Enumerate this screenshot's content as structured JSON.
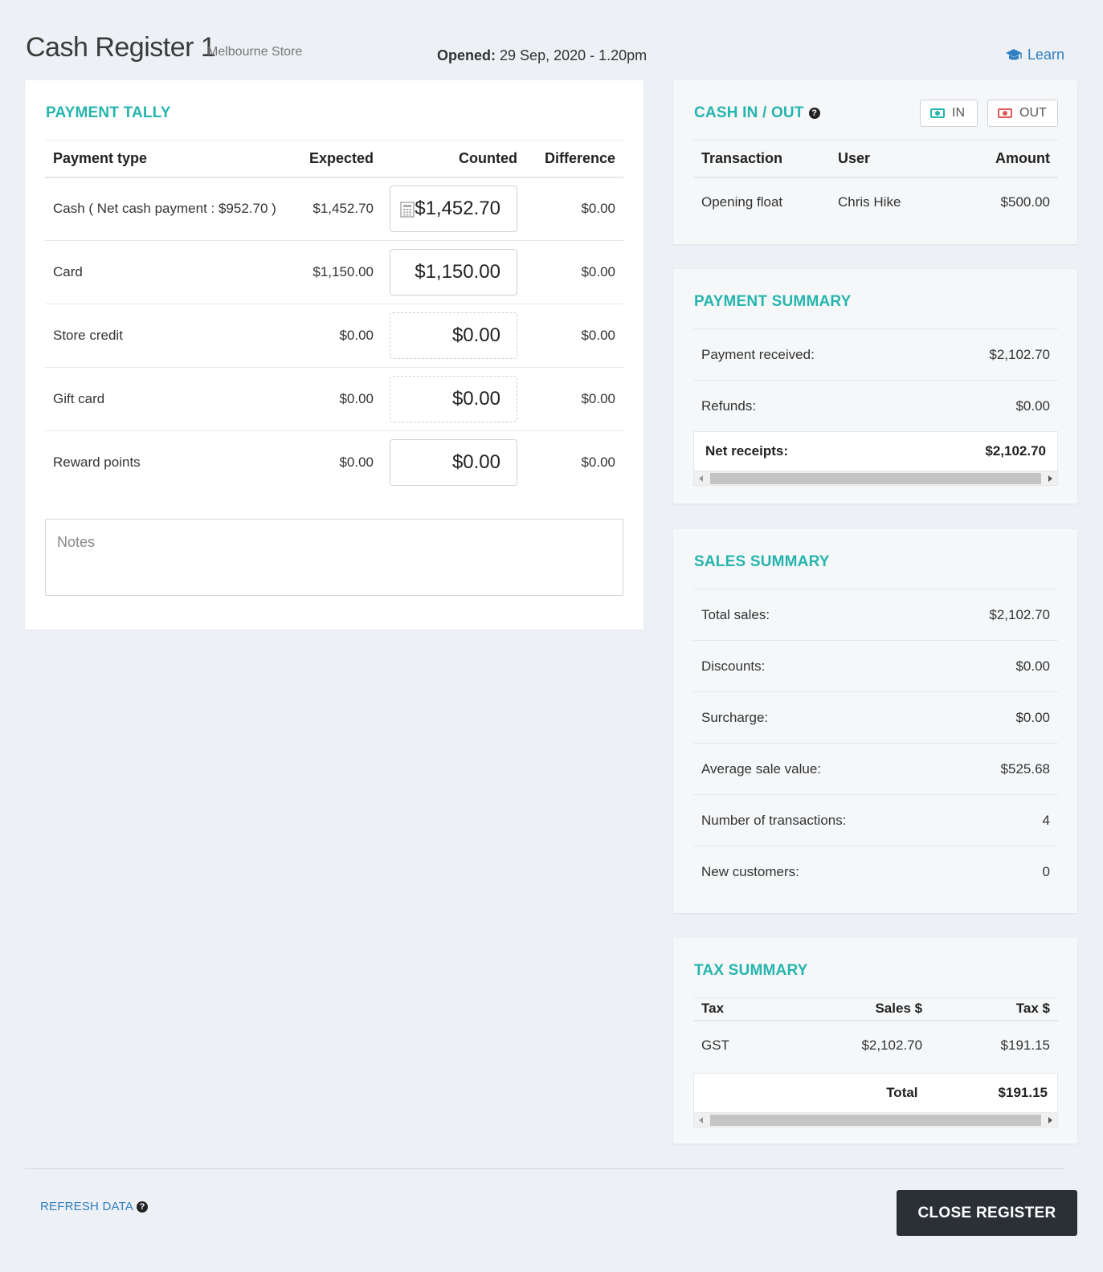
{
  "header": {
    "title": "Cash Register 1",
    "store": "Melbourne Store",
    "opened_label": "Opened:",
    "opened_value": "29 Sep, 2020 - 1.20pm",
    "learn": "Learn"
  },
  "tally": {
    "title": "PAYMENT TALLY",
    "columns": [
      "Payment type",
      "Expected",
      "Counted",
      "Difference"
    ],
    "rows": [
      {
        "type": "Cash ( Net cash payment : $952.70 )",
        "expected": "$1,452.70",
        "counted": "$1,452.70",
        "difference": "$0.00"
      },
      {
        "type": "Card",
        "expected": "$1,150.00",
        "counted": "$1,150.00",
        "difference": "$0.00"
      },
      {
        "type": "Store credit",
        "expected": "$0.00",
        "counted": "$0.00",
        "difference": "$0.00"
      },
      {
        "type": "Gift card",
        "expected": "$0.00",
        "counted": "$0.00",
        "difference": "$0.00"
      },
      {
        "type": "Reward points",
        "expected": "$0.00",
        "counted": "$0.00",
        "difference": "$0.00"
      }
    ],
    "notes_placeholder": "Notes"
  },
  "cash": {
    "title": "CASH IN / OUT",
    "in_label": "IN",
    "out_label": "OUT",
    "columns": [
      "Transaction",
      "User",
      "Amount"
    ],
    "rows": [
      {
        "transaction": "Opening float",
        "user": "Chris Hike",
        "amount": "$500.00"
      }
    ]
  },
  "payment_summary": {
    "title": "PAYMENT SUMMARY",
    "received_label": "Payment received:",
    "received_value": "$2,102.70",
    "refunds_label": "Refunds:",
    "refunds_value": "$0.00",
    "net_label": "Net receipts:",
    "net_value": "$2,102.70"
  },
  "sales_summary": {
    "title": "SALES SUMMARY",
    "rows": [
      {
        "label": "Total sales:",
        "value": "$2,102.70"
      },
      {
        "label": "Discounts:",
        "value": "$0.00"
      },
      {
        "label": "Surcharge:",
        "value": "$0.00"
      },
      {
        "label": "Average sale value:",
        "value": "$525.68"
      },
      {
        "label": "Number of transactions:",
        "value": "4"
      },
      {
        "label": "New customers:",
        "value": "0"
      }
    ]
  },
  "tax_summary": {
    "title": "TAX SUMMARY",
    "columns": [
      "Tax",
      "Sales $",
      "Tax $"
    ],
    "rows": [
      {
        "tax": "GST",
        "sales": "$2,102.70",
        "tax_amount": "$191.15"
      }
    ],
    "total_label": "Total",
    "total_value": "$191.15"
  },
  "footer": {
    "refresh": "REFRESH DATA",
    "close": "CLOSE REGISTER"
  },
  "colors": {
    "accent": "#26b5ad",
    "link": "#2f7fc1",
    "dark_button": "#2b2f36",
    "background": "#edf0f4"
  },
  "icons": [
    "graduation-cap-icon",
    "help-icon",
    "calculator-icon",
    "cash-in-icon",
    "cash-out-icon"
  ]
}
